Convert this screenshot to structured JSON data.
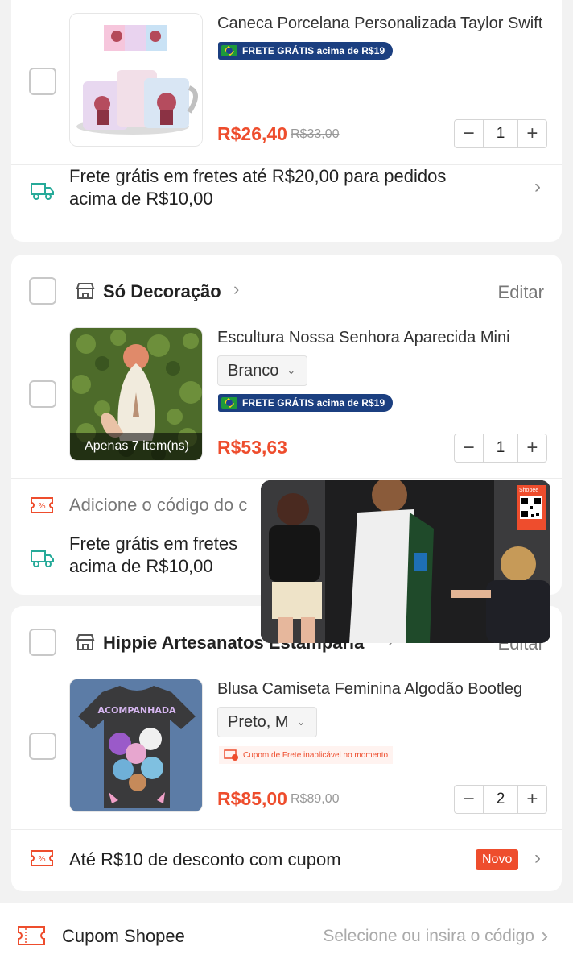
{
  "card1": {
    "product": {
      "title": "Caneca Porcelana Personalizada Taylor Swift",
      "badge": "FRETE GRÁTIS acima de R$19",
      "price": "R$26,40",
      "old_price": "R$33,00",
      "quantity": "1"
    },
    "shipping_text_line1": "Frete grátis em fretes até R$20,00 para pedidos",
    "shipping_text_line2": "acima de R$10,00"
  },
  "card2": {
    "shop_name": "Só Decoração",
    "edit_label": "Editar",
    "product": {
      "title": "Escultura Nossa Senhora Aparecida Mini",
      "variant": "Branco",
      "badge": "FRETE GRÁTIS acima de R$19",
      "stock_label": "Apenas 7 item(ns)",
      "price": "R$53,63",
      "quantity": "1"
    },
    "coupon_text": "Adicione o código do c",
    "shipping_text_line1": "Frete grátis em fretes",
    "shipping_text_line2": "acima de R$10,00"
  },
  "card3": {
    "shop_name": "Hippie Artesanatos Estamparia",
    "edit_label": "Editar",
    "product": {
      "title": "Blusa Camiseta Feminina Algodão Bootleg",
      "variant": "Preto, M",
      "warning": "Cupom de Frete inaplicável no momento",
      "price": "R$85,00",
      "old_price": "R$89,00",
      "quantity": "2"
    },
    "coupon_text": "Até R$10 de desconto com cupom",
    "new_badge": "Novo"
  },
  "video_overlay": {
    "brand": "Shopee"
  },
  "bottom_bar": {
    "label": "Cupom Shopee",
    "placeholder": "Selecione ou insira o código"
  },
  "colors": {
    "accent": "#ee4d2d",
    "teal": "#26aa99",
    "badge_blue": "#1b3f80"
  },
  "icons": {
    "truck": "truck-icon",
    "shop": "shop-icon",
    "coupon": "coupon-icon",
    "chevron": "chevron-right-icon",
    "caret": "chevron-down-icon"
  }
}
